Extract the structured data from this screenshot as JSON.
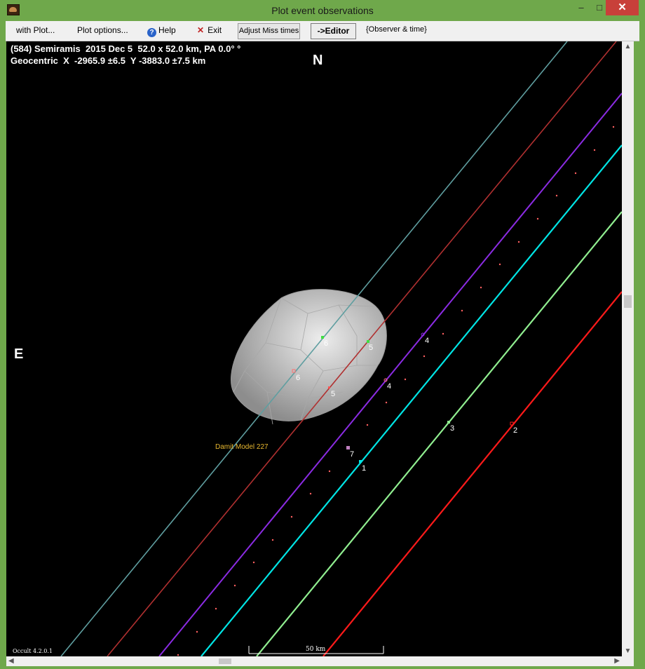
{
  "window": {
    "title": "Plot event observations"
  },
  "title_buttons": {
    "minimize": "–",
    "maximize": "□",
    "close": "✕"
  },
  "menu": {
    "with_plot": "with Plot...",
    "plot_options": "Plot options...",
    "help": "Help",
    "exit": "Exit",
    "adjust_miss_times": "Adjust Miss times",
    "editor": "->Editor",
    "observer_time": "{Observer & time}"
  },
  "plot": {
    "header_line1": "(584) Semiramis  2015 Dec 5  52.0 x 52.0 km, PA 0.0° °",
    "header_line2": "Geocentric  X  -2965.9 ±6.5  Y -3883.0 ±7.5 km",
    "north": "N",
    "east": "E",
    "model_label": "Damit Model 227",
    "scale_label": "50 km",
    "version": "Occult 4.2.0.1",
    "colors": {
      "background": "#000000",
      "shape": "#b8b8b8",
      "model_label": "#e8b830"
    },
    "chords": [
      {
        "id": "1",
        "color": "#00e5e5"
      },
      {
        "id": "2",
        "color": "#ff1a1a"
      },
      {
        "id": "3",
        "color": "#90ee90"
      },
      {
        "id": "4",
        "color": "#8a2be2"
      },
      {
        "id": "5",
        "color": "#b03030"
      },
      {
        "id": "6",
        "color": "#5f9ea0"
      },
      {
        "id": "7",
        "color": "#c080c0"
      }
    ]
  }
}
